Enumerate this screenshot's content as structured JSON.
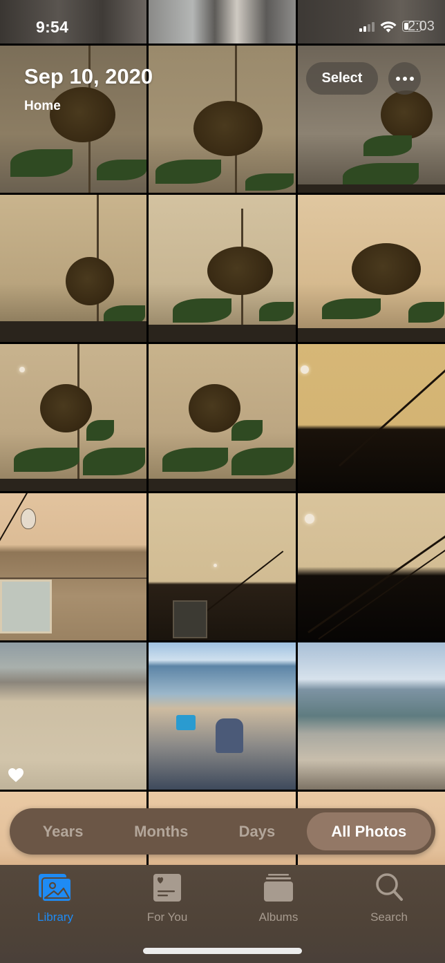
{
  "status_bar": {
    "time": "9:54",
    "battery_text": "2:03",
    "icons": [
      "signal-icon",
      "wifi-icon",
      "battery-icon"
    ]
  },
  "header": {
    "title": "Sep 10, 2020",
    "subtitle": "Home",
    "select_label": "Select",
    "more_icon": "ellipsis-icon"
  },
  "grid": {
    "photos": [
      {
        "id": "top-1",
        "desc": "partial photo"
      },
      {
        "id": "top-2",
        "desc": "partial photo"
      },
      {
        "id": "top-3",
        "desc": "partial photo"
      },
      {
        "id": "sunflower-1",
        "desc": "wilted sunflower against hazy sky"
      },
      {
        "id": "sunflower-2",
        "desc": "wilted sunflower against hazy sky"
      },
      {
        "id": "sunflower-3",
        "desc": "wilted sunflower against hazy sky"
      },
      {
        "id": "sunflower-4",
        "desc": "wilted sunflower against hazy sky"
      },
      {
        "id": "sunflower-5",
        "desc": "wilted sunflower against hazy sky"
      },
      {
        "id": "sunflower-6",
        "desc": "wilted sunflower against hazy sky"
      },
      {
        "id": "sunflower-7",
        "desc": "wilted sunflower against hazy sky"
      },
      {
        "id": "sunflower-8",
        "desc": "wilted sunflower against hazy sky"
      },
      {
        "id": "sky-1",
        "desc": "orange sky over rooftop with wire"
      },
      {
        "id": "house-1",
        "desc": "house with light bulb under orange sky"
      },
      {
        "id": "house-2",
        "desc": "house under orange sky with wire"
      },
      {
        "id": "sky-2",
        "desc": "orange sky with sun and wires"
      },
      {
        "id": "beach-1",
        "desc": "seagulls on beach",
        "favorite": true
      },
      {
        "id": "beach-2",
        "desc": "child playing in sand at beach"
      },
      {
        "id": "beach-3",
        "desc": "ocean waves on beach"
      },
      {
        "id": "kid-1",
        "desc": "partial photo"
      },
      {
        "id": "kid-2",
        "desc": "partial photo"
      },
      {
        "id": "kid-3",
        "desc": "partial photo"
      }
    ]
  },
  "segmented_control": {
    "options": [
      "Years",
      "Months",
      "Days",
      "All Photos"
    ],
    "selected": "All Photos"
  },
  "tab_bar": {
    "tabs": [
      {
        "label": "Library",
        "icon": "photo-library-icon",
        "active": true
      },
      {
        "label": "For You",
        "icon": "for-you-icon",
        "active": false
      },
      {
        "label": "Albums",
        "icon": "albums-icon",
        "active": false
      },
      {
        "label": "Search",
        "icon": "search-icon",
        "active": false
      }
    ],
    "active_color": "#1e8bf5",
    "inactive_color": "#a79b8f"
  }
}
